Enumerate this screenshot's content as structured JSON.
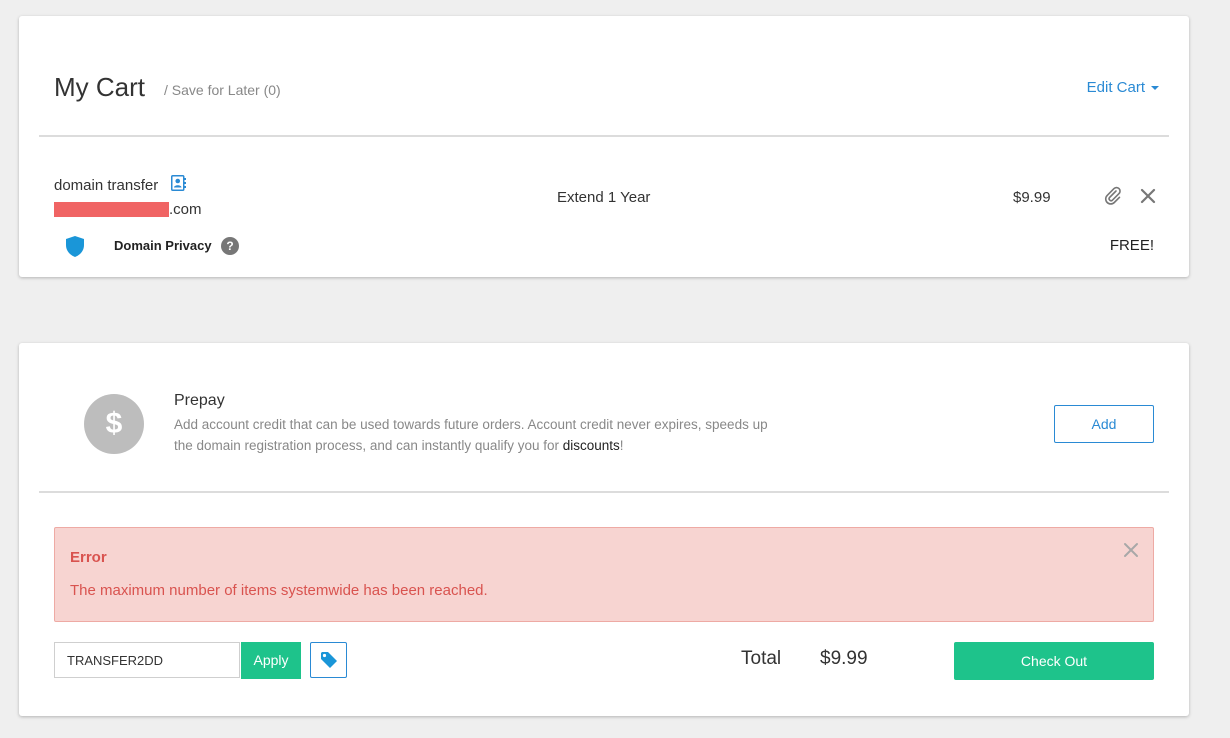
{
  "cart": {
    "title": "My Cart",
    "save_for_later": "/ Save for Later (0)",
    "edit_cart": "Edit Cart",
    "item": {
      "type": "domain transfer",
      "domain_suffix": ".com",
      "term": "Extend 1 Year",
      "price": "$9.99"
    },
    "privacy": {
      "label": "Domain Privacy",
      "help": "?",
      "price": "FREE!"
    }
  },
  "prepay": {
    "icon_symbol": "$",
    "title": "Prepay",
    "description": "Add account credit that can be used towards future orders. Account credit never expires, speeds up the domain registration process, and can instantly qualify you for ",
    "link": "discounts",
    "suffix": "!",
    "add_button": "Add"
  },
  "error": {
    "title": "Error",
    "message": "The maximum number of items systemwide has been reached."
  },
  "checkout": {
    "promo_code": "TRANSFER2DD",
    "apply_button": "Apply",
    "total_label": "Total",
    "total_value": "$9.99",
    "checkout_button": "Check Out"
  },
  "colors": {
    "accent_blue": "#2a8ad4",
    "green": "#1ec38b",
    "error_red": "#d9534f",
    "error_bg": "#f7d4d1"
  }
}
